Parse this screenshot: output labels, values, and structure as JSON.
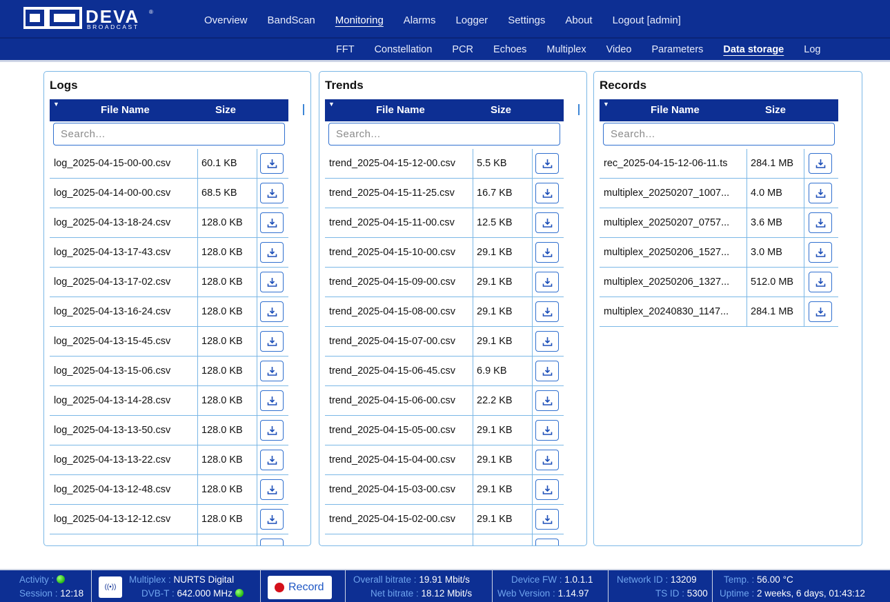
{
  "brand": {
    "name": "DEVA",
    "sub": "BROADCAST",
    "mark": "®"
  },
  "nav": {
    "main": [
      "Overview",
      "BandScan",
      "Monitoring",
      "Alarms",
      "Logger",
      "Settings",
      "About",
      "Logout [admin]"
    ],
    "main_active": "Monitoring",
    "sub": [
      "FFT",
      "Constellation",
      "PCR",
      "Echoes",
      "Multiplex",
      "Video",
      "Parameters",
      "Data storage",
      "Log"
    ],
    "sub_active": "Data storage"
  },
  "table_headers": {
    "file_name": "File Name",
    "size": "Size",
    "search_placeholder": "Search..."
  },
  "logs": {
    "title": "Logs",
    "rows": [
      {
        "name": "log_2025-04-15-00-00.csv",
        "size": "60.1 KB"
      },
      {
        "name": "log_2025-04-14-00-00.csv",
        "size": "68.5 KB"
      },
      {
        "name": "log_2025-04-13-18-24.csv",
        "size": "128.0 KB"
      },
      {
        "name": "log_2025-04-13-17-43.csv",
        "size": "128.0 KB"
      },
      {
        "name": "log_2025-04-13-17-02.csv",
        "size": "128.0 KB"
      },
      {
        "name": "log_2025-04-13-16-24.csv",
        "size": "128.0 KB"
      },
      {
        "name": "log_2025-04-13-15-45.csv",
        "size": "128.0 KB"
      },
      {
        "name": "log_2025-04-13-15-06.csv",
        "size": "128.0 KB"
      },
      {
        "name": "log_2025-04-13-14-28.csv",
        "size": "128.0 KB"
      },
      {
        "name": "log_2025-04-13-13-50.csv",
        "size": "128.0 KB"
      },
      {
        "name": "log_2025-04-13-13-22.csv",
        "size": "128.0 KB"
      },
      {
        "name": "log_2025-04-13-12-48.csv",
        "size": "128.0 KB"
      },
      {
        "name": "log_2025-04-13-12-12.csv",
        "size": "128.0 KB"
      }
    ]
  },
  "trends": {
    "title": "Trends",
    "rows": [
      {
        "name": "trend_2025-04-15-12-00.csv",
        "size": "5.5 KB"
      },
      {
        "name": "trend_2025-04-15-11-25.csv",
        "size": "16.7 KB"
      },
      {
        "name": "trend_2025-04-15-11-00.csv",
        "size": "12.5 KB"
      },
      {
        "name": "trend_2025-04-15-10-00.csv",
        "size": "29.1 KB"
      },
      {
        "name": "trend_2025-04-15-09-00.csv",
        "size": "29.1 KB"
      },
      {
        "name": "trend_2025-04-15-08-00.csv",
        "size": "29.1 KB"
      },
      {
        "name": "trend_2025-04-15-07-00.csv",
        "size": "29.1 KB"
      },
      {
        "name": "trend_2025-04-15-06-45.csv",
        "size": "6.9 KB"
      },
      {
        "name": "trend_2025-04-15-06-00.csv",
        "size": "22.2 KB"
      },
      {
        "name": "trend_2025-04-15-05-00.csv",
        "size": "29.1 KB"
      },
      {
        "name": "trend_2025-04-15-04-00.csv",
        "size": "29.1 KB"
      },
      {
        "name": "trend_2025-04-15-03-00.csv",
        "size": "29.1 KB"
      },
      {
        "name": "trend_2025-04-15-02-00.csv",
        "size": "29.1 KB"
      }
    ]
  },
  "records": {
    "title": "Records",
    "rows": [
      {
        "name": "rec_2025-04-15-12-06-11.ts",
        "size": "284.1 MB"
      },
      {
        "name": "multiplex_20250207_1007...",
        "size": "4.0 MB"
      },
      {
        "name": "multiplex_20250207_0757...",
        "size": "3.6 MB"
      },
      {
        "name": "multiplex_20250206_1527...",
        "size": "3.0 MB"
      },
      {
        "name": "multiplex_20250206_1327...",
        "size": "512.0 MB"
      },
      {
        "name": "multiplex_20240830_1147...",
        "size": "284.1 MB"
      }
    ]
  },
  "status": {
    "activity_label": "Activity :",
    "session_label": "Session :",
    "session_value": "12:18",
    "multiplex_label": "Multiplex :",
    "multiplex_value": "NURTS Digital",
    "dvbt_label": "DVB-T :",
    "dvbt_value": "642.000 MHz",
    "mux_icon": "((•))",
    "record_label": "Record",
    "overall_label": "Overall bitrate :",
    "overall_value": "19.91 Mbit/s",
    "net_label": "Net bitrate :",
    "net_value": "18.12 Mbit/s",
    "fw_label": "Device FW :",
    "fw_value": "1.0.1.1",
    "web_label": "Web Version :",
    "web_value": "1.14.97",
    "netid_label": "Network ID :",
    "netid_value": "13209",
    "tsid_label": "TS ID :",
    "tsid_value": "5300",
    "temp_label": "Temp. :",
    "temp_value": "56.00 °C",
    "uptime_label": "Uptime :",
    "uptime_value": "2 weeks, 6 days, 01:43:12"
  },
  "colors": {
    "nav_bg": "#0d2f93",
    "border": "#7ab7e6",
    "accent": "#2f6fcf",
    "record": "#d4101a",
    "ok": "#2bbf18"
  }
}
